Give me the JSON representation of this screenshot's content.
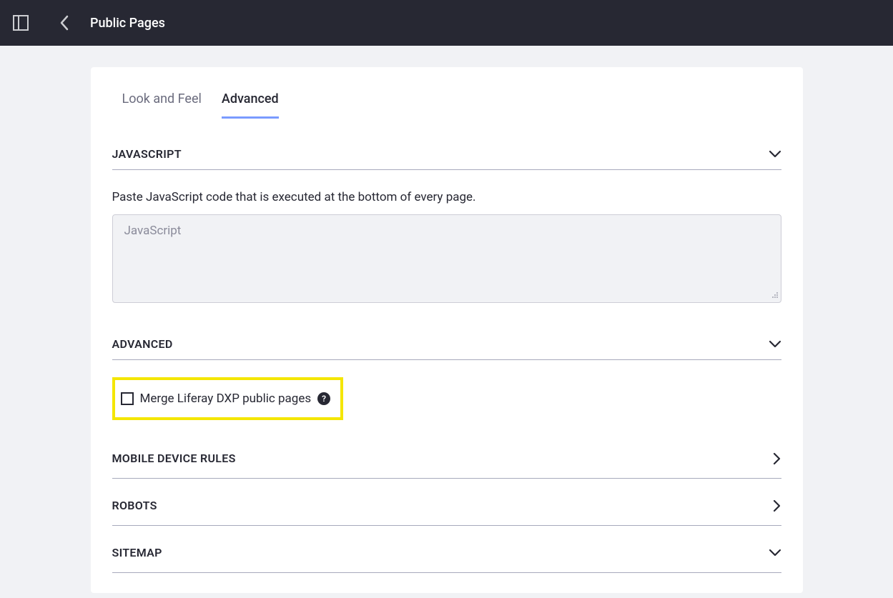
{
  "header": {
    "title": "Public Pages"
  },
  "tabs": [
    {
      "label": "Look and Feel",
      "active": false
    },
    {
      "label": "Advanced",
      "active": true
    }
  ],
  "sections": {
    "javascript": {
      "title": "JAVASCRIPT",
      "description": "Paste JavaScript code that is executed at the bottom of every page.",
      "placeholder": "JavaScript",
      "value": ""
    },
    "advanced": {
      "title": "ADVANCED",
      "checkbox_label": "Merge Liferay DXP public pages",
      "checkbox_checked": false,
      "help_glyph": "?"
    },
    "mobile": {
      "title": "MOBILE DEVICE RULES"
    },
    "robots": {
      "title": "ROBOTS"
    },
    "sitemap": {
      "title": "SITEMAP"
    }
  }
}
